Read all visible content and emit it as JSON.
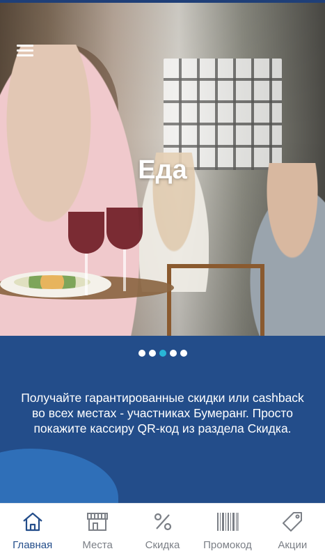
{
  "hero": {
    "title": "Еда",
    "slides_total": 5,
    "active_slide": 3
  },
  "info": {
    "text": "Получайте гарантированные скидки или cashback во всех местах - участниках Бумеранг. Просто покажите кассиру QR-код из раздела Скидка."
  },
  "tabs": [
    {
      "label": "Главная",
      "icon": "home-icon",
      "active": true
    },
    {
      "label": "Места",
      "icon": "storefront-icon",
      "active": false
    },
    {
      "label": "Скидка",
      "icon": "percent-icon",
      "active": false
    },
    {
      "label": "Промокод",
      "icon": "barcode-icon",
      "active": false
    },
    {
      "label": "Акции",
      "icon": "tag-icon",
      "active": false
    }
  ],
  "colors": {
    "brand_blue": "#234d8a",
    "accent_cyan": "#29b6d6",
    "inactive_gray": "#7b7f86"
  }
}
